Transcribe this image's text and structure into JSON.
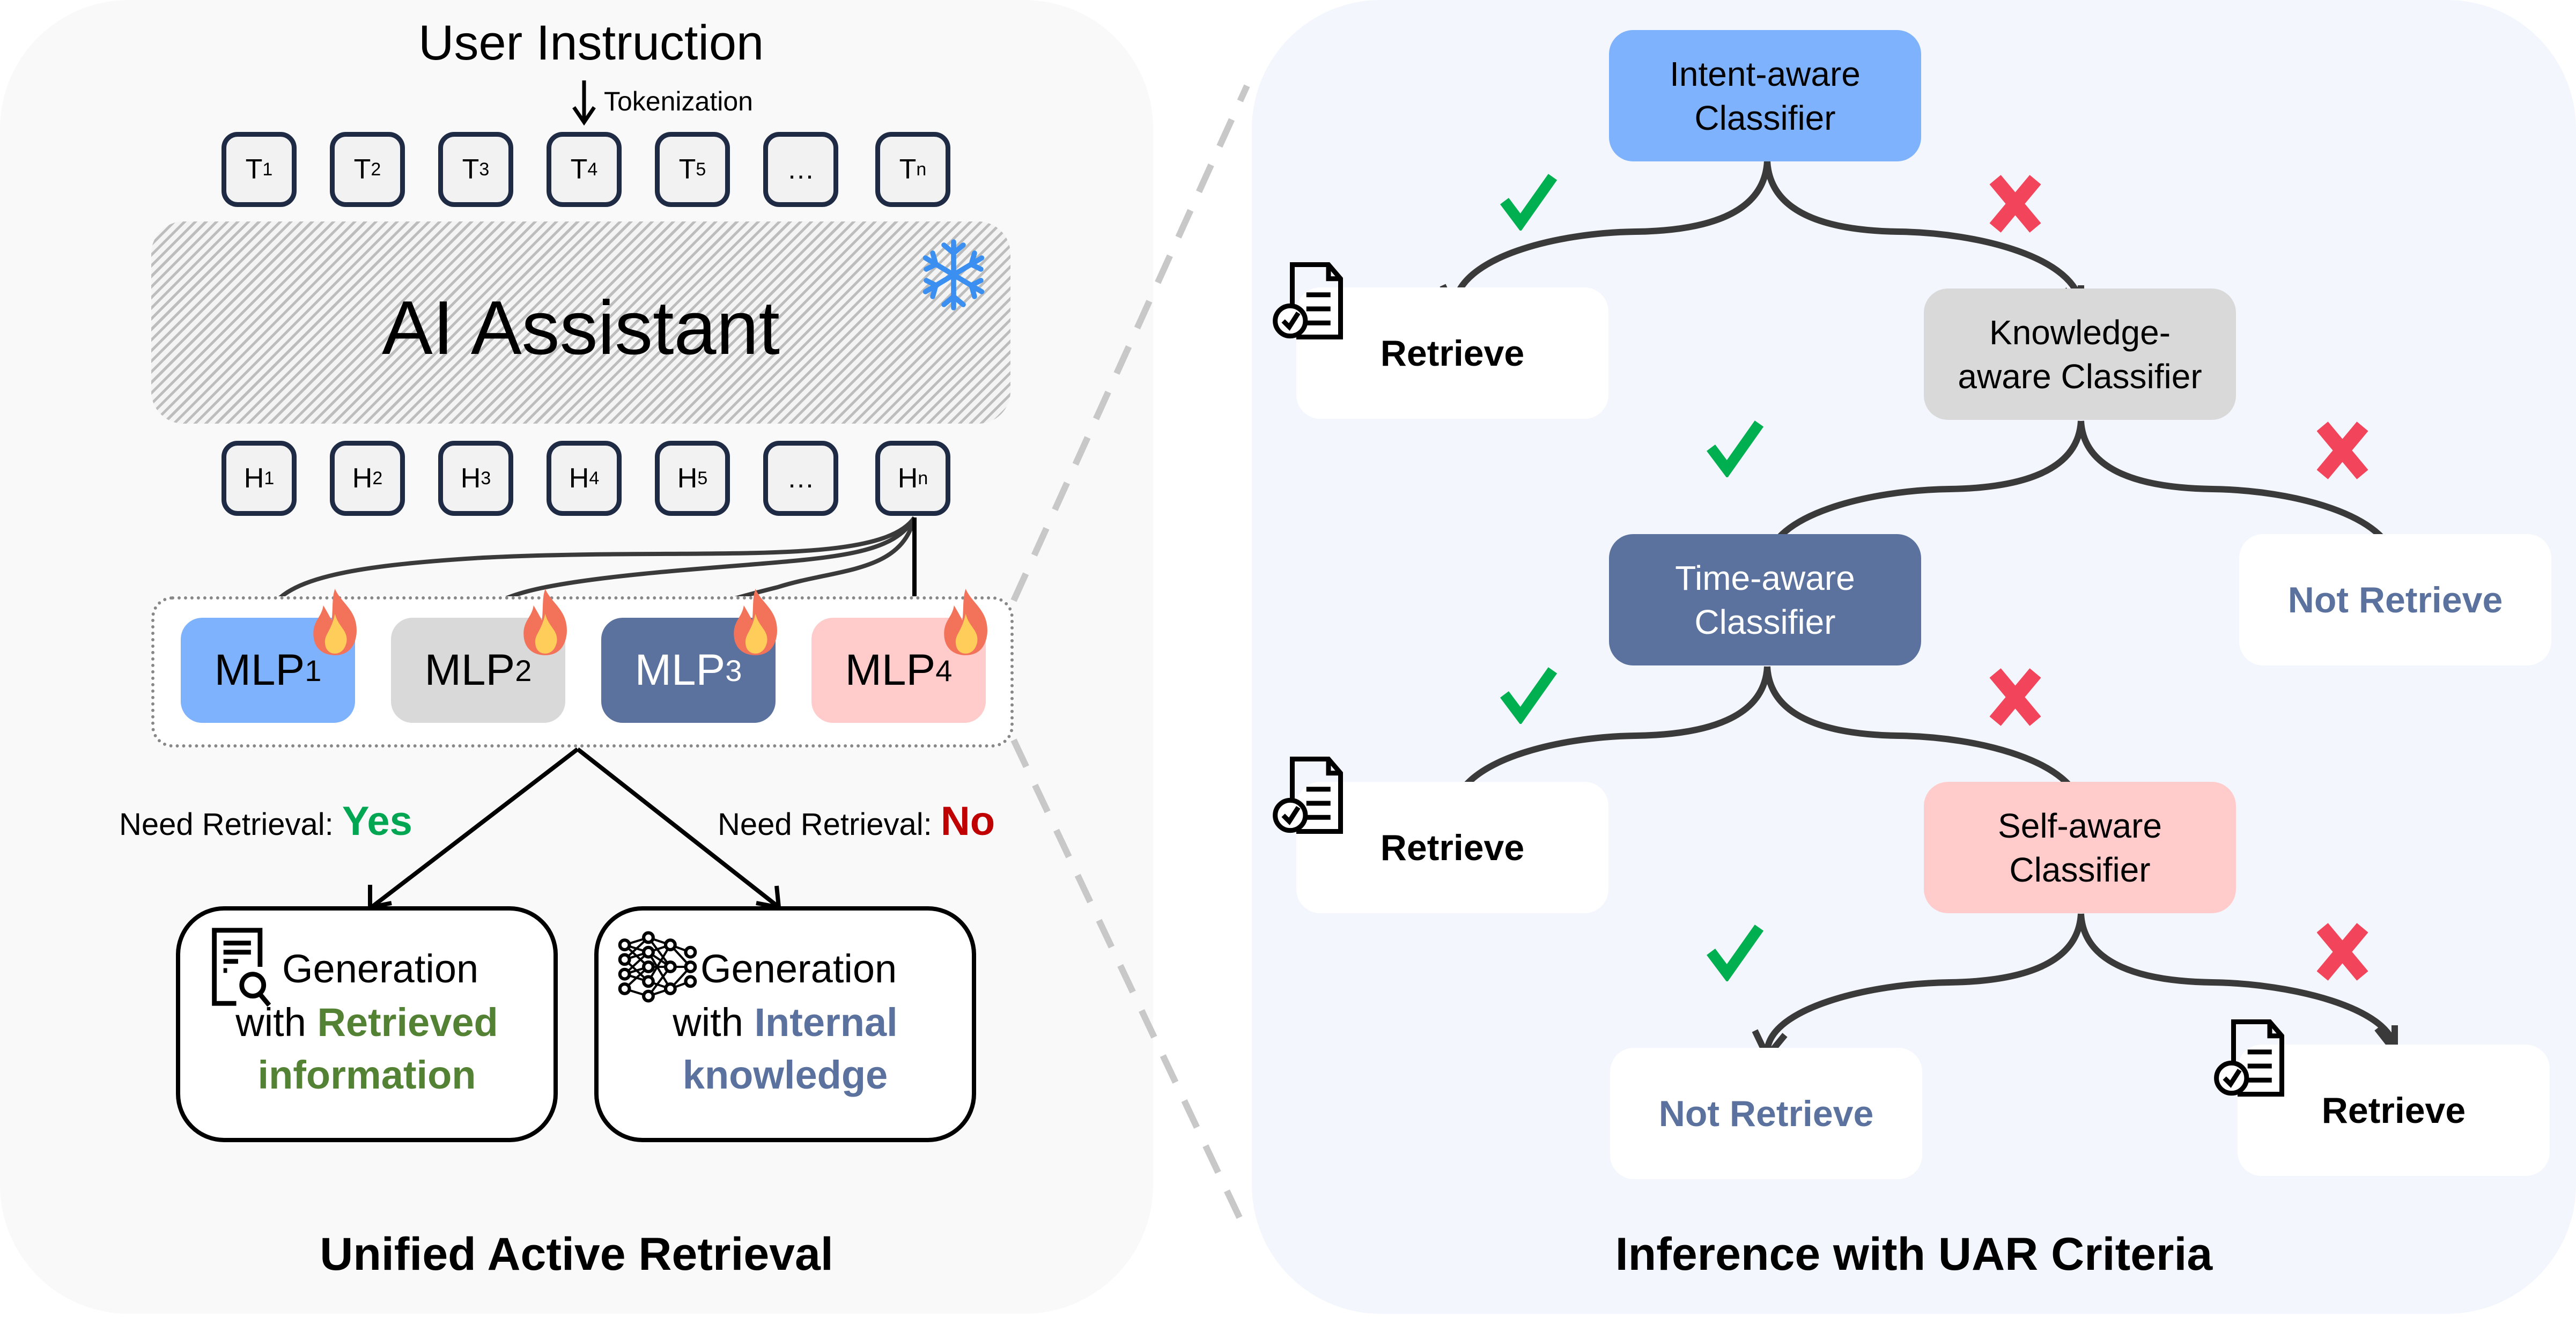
{
  "left_panel": {
    "title": "Unified Active Retrieval",
    "user_instruction": "User Instruction",
    "tokenization_label": "Tokenization",
    "tokens": [
      {
        "base": "T",
        "sub": "1"
      },
      {
        "base": "T",
        "sub": "2"
      },
      {
        "base": "T",
        "sub": "3"
      },
      {
        "base": "T",
        "sub": "4"
      },
      {
        "base": "T",
        "sub": "5"
      },
      {
        "base": "…",
        "sub": ""
      },
      {
        "base": "T",
        "sub": "n"
      }
    ],
    "model_label": "AI Assistant",
    "model_state_icon": "snowflake-icon",
    "hidden_states": [
      {
        "base": "H",
        "sub": "1"
      },
      {
        "base": "H",
        "sub": "2"
      },
      {
        "base": "H",
        "sub": "3"
      },
      {
        "base": "H",
        "sub": "4"
      },
      {
        "base": "H",
        "sub": "5"
      },
      {
        "base": "…",
        "sub": ""
      },
      {
        "base": "H",
        "sub": "n"
      }
    ],
    "mlps": [
      {
        "base": "MLP",
        "sub": "1",
        "color": "#7fb2fd",
        "text_color": "#000000",
        "icon": "flame-icon"
      },
      {
        "base": "MLP",
        "sub": "2",
        "color": "#d9d9d9",
        "text_color": "#000000",
        "icon": "flame-icon"
      },
      {
        "base": "MLP",
        "sub": "3",
        "color": "#5b729e",
        "text_color": "#ffffff",
        "icon": "flame-icon"
      },
      {
        "base": "MLP",
        "sub": "4",
        "color": "#ffcccb",
        "text_color": "#000000",
        "icon": "flame-icon"
      }
    ],
    "decision_yes": {
      "prefix": "Need Retrieval: ",
      "value": "Yes",
      "color": "#00a651"
    },
    "decision_no": {
      "prefix": "Need Retrieval: ",
      "value": "No",
      "color": "#c00000"
    },
    "gen_retrieved": {
      "line1": "Generation",
      "line2_prefix": "with ",
      "line2_em": "Retrieved",
      "line3_em": "information",
      "em_color": "#548235",
      "icon": "document-search-icon"
    },
    "gen_internal": {
      "line1": "Generation",
      "line2_prefix": "with ",
      "line2_em": "Internal",
      "line3_em": "knowledge",
      "em_color": "#5b729e",
      "icon": "neural-network-icon"
    }
  },
  "right_panel": {
    "title": "Inference with UAR Criteria",
    "classifiers": [
      {
        "line1": "Intent-aware",
        "line2": "Classifier",
        "color": "#7fb2fd",
        "text_color": "#000000"
      },
      {
        "line1": "Knowledge-",
        "line2": "aware Classifier",
        "color": "#d9d9d9",
        "text_color": "#000000"
      },
      {
        "line1": "Time-aware",
        "line2": "Classifier",
        "color": "#5b729e",
        "text_color": "#ffffff"
      },
      {
        "line1": "Self-aware",
        "line2": "Classifier",
        "color": "#ffcccb",
        "text_color": "#000000"
      }
    ],
    "leaves": [
      {
        "label": "Retrieve",
        "color": "#000000",
        "icon": "document-check-icon"
      },
      {
        "label": "Not Retrieve",
        "color": "#5b729e",
        "icon": ""
      },
      {
        "label": "Retrieve",
        "color": "#000000",
        "icon": "document-check-icon"
      },
      {
        "label": "Not Retrieve",
        "color": "#5b729e",
        "icon": ""
      },
      {
        "label": "Retrieve",
        "color": "#000000",
        "icon": "document-check-icon"
      }
    ],
    "yes_mark_color": "#00b050",
    "no_mark_color": "#f2445a"
  }
}
